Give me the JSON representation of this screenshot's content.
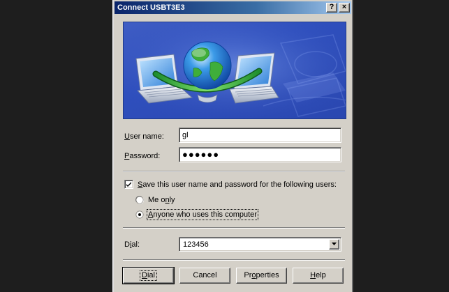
{
  "window": {
    "title": "Connect USBT3E3",
    "help_glyph": "?",
    "close_glyph": "×"
  },
  "form": {
    "username": {
      "label_accel": "U",
      "label_rest": "ser name:",
      "value": "gl"
    },
    "password": {
      "label_accel": "P",
      "label_rest": "assword:",
      "value": "●●●●●●"
    }
  },
  "save_checkbox": {
    "label_accel": "S",
    "label_rest": "ave this user name and password for the following users:",
    "checked": true
  },
  "radios": [
    {
      "label_pre": "Me o",
      "label_accel": "n",
      "label_post": "ly",
      "selected": false
    },
    {
      "label_pre": "",
      "label_accel": "A",
      "label_post": "nyone who uses this computer",
      "selected": true
    }
  ],
  "dial": {
    "label_pre": "D",
    "label_accel": "i",
    "label_post": "al:",
    "value": "123456"
  },
  "buttons": {
    "dial": {
      "accel": "D",
      "rest": "ial"
    },
    "cancel": {
      "label": "Cancel"
    },
    "properties": {
      "accel": "",
      "pre": "Pr",
      "accel_char": "o",
      "post": "perties"
    },
    "help": {
      "accel": "H",
      "rest": "elp"
    }
  },
  "icons": {
    "banner": "network-globe-laptops-illustration",
    "help": "help-icon",
    "close": "close-icon",
    "dropdown": "chevron-down-icon",
    "check": "checkmark-icon"
  },
  "colors": {
    "titlebar_start": "#0a246a",
    "titlebar_end": "#a6caf0",
    "face": "#d4d0c8",
    "banner_blue": "#2f4fbd"
  }
}
